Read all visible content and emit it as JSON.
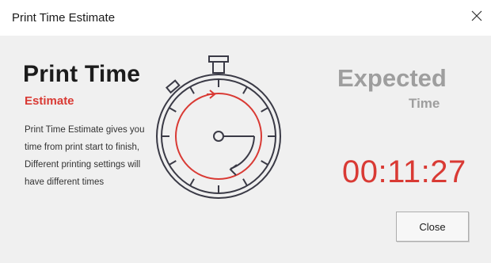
{
  "window": {
    "title": "Print Time Estimate"
  },
  "panel": {
    "heading": "Print Time",
    "subheading": "Estimate",
    "description_lines": [
      "Print Time Estimate gives you",
      "time from print start to finish,",
      "Different printing settings will",
      "have different times"
    ]
  },
  "result": {
    "label_main": "Expected",
    "label_sub": "Time",
    "value": "00:11:27"
  },
  "buttons": {
    "close_label": "Close"
  },
  "icons": {
    "window_close": "close-icon",
    "illustration": "stopwatch-icon"
  },
  "colors": {
    "accent": "#d93a34",
    "muted": "#9e9e9e",
    "text": "#1c1c1c",
    "background": "#f0f0f0"
  }
}
